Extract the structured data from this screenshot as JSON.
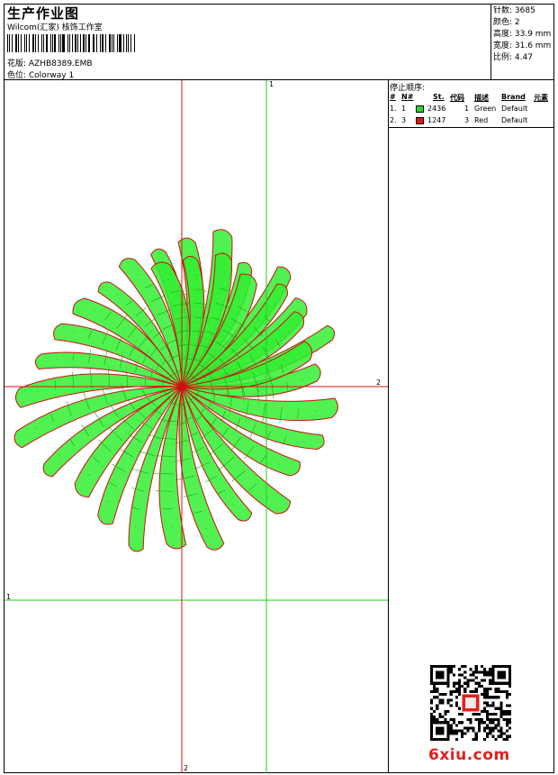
{
  "header": {
    "title": "生产作业图",
    "subtitle": "Wilcom(汇家) 核饰工作室",
    "design_label": "花版: AZHB8389.EMB",
    "colorway_label": "色位: Colorway 1"
  },
  "stats": {
    "stitches": "针数: 3685",
    "colors": "颜色: 2",
    "height": "高度: 33.9 mm",
    "width": "宽度: 31.6 mm",
    "ratio": "比例: 4.47"
  },
  "stop_sequence": {
    "title": "停止顺序:",
    "headers": [
      "#",
      "N#",
      "St.",
      "代码",
      "描述",
      "Brand",
      "元素"
    ],
    "rows": [
      {
        "index": "1.",
        "needle": "1",
        "color": "#22dd22",
        "stitches": "2436",
        "code": "1",
        "description": "Green",
        "brand": "Default"
      },
      {
        "index": "2.",
        "needle": "3",
        "color": "#ee1111",
        "stitches": "1247",
        "code": "3",
        "description": "Red",
        "brand": "Default"
      }
    ]
  },
  "design": {
    "fill_color": "#33ee33",
    "outline_color": "#cc1111",
    "green_axis_color": "#22cc22",
    "red_axis_color": "#dd1111",
    "labels": {
      "top_green": "1",
      "left_green": "1",
      "bottom_red": "2",
      "right_red": "2"
    }
  },
  "footer": {
    "logo": "6xiu.com"
  }
}
